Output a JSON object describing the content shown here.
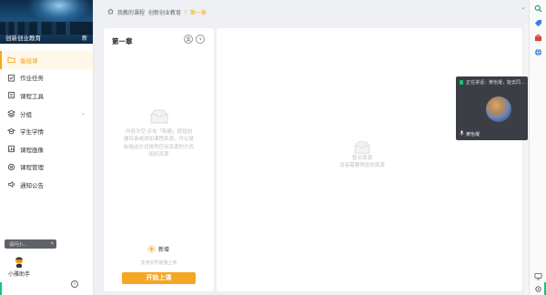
{
  "sidebar": {
    "banner_title": "创新创业教育",
    "banner_tag": "新",
    "menu": [
      {
        "label": "备授课",
        "icon": "folder-icon",
        "active": true
      },
      {
        "label": "作业任务",
        "icon": "task-icon"
      },
      {
        "label": "课程工具",
        "icon": "toolbox-icon"
      },
      {
        "label": "分组",
        "icon": "layers-icon",
        "expandable": true
      },
      {
        "label": "学生学情",
        "icon": "student-icon"
      },
      {
        "label": "课程画像",
        "icon": "portrait-icon"
      },
      {
        "label": "课程管理",
        "icon": "settings-icon"
      },
      {
        "label": "通知公告",
        "icon": "speaker-icon"
      }
    ],
    "ask_placeholder": "请问小...",
    "assistant_label": "小雅助手"
  },
  "breadcrumb": {
    "home": "我教的课程",
    "course": "创新创业教育",
    "sep": "/",
    "current": "第一章"
  },
  "chapter_panel": {
    "title": "第一章",
    "empty_text": "内容为空 点击「新建」按钮创建目录或添加课程资源，可以鼠标拖动方式排列任何资源的方式组织资源",
    "add_label": "新增",
    "hint": "支持文件拖拽上传",
    "start_button": "开始上课"
  },
  "main_panel": {
    "empty_title": "暂无资源",
    "empty_sub": "没有需要预览的资源"
  },
  "speaker_window": {
    "status": "正在讲话：黄怡凝，能去同…",
    "name": "黄怡凝"
  },
  "colors": {
    "accent": "#f5a623",
    "accent_light": "#fff7e8",
    "speaker_bg": "#3b3e44",
    "live_green": "#19c37d"
  }
}
